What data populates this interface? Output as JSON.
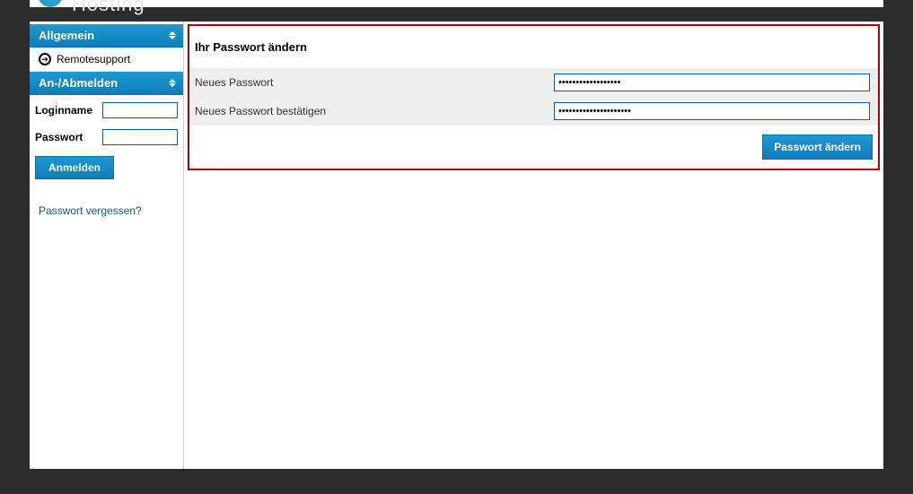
{
  "header": {
    "logo_text": "Hosting"
  },
  "sidebar": {
    "section_general": "Allgemein",
    "item_remote": "Remotesupport",
    "section_login": "An-/Abmelden",
    "login": {
      "loginname_label": "Loginname",
      "loginname_value": "",
      "password_label": "Passwort",
      "password_value": "",
      "submit_label": "Anmelden",
      "forgot_label": "Passwort vergessen?"
    }
  },
  "main": {
    "panel_title": "Ihr Passwort ändern",
    "new_password_label": "Neues Passwort",
    "new_password_value": "••••••••••••••••••",
    "confirm_password_label": "Neues Passwort bestätigen",
    "confirm_password_value": "•••••••••••••••••••••",
    "submit_label": "Passwort ändern"
  }
}
